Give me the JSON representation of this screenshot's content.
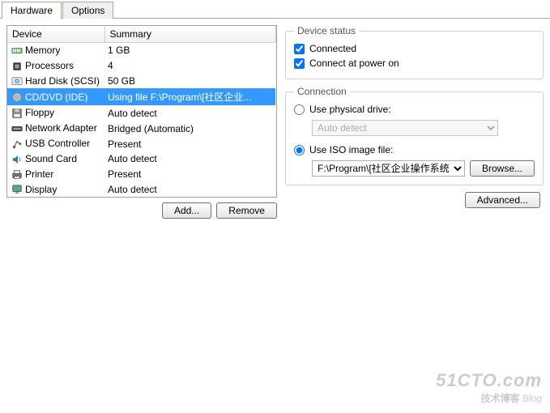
{
  "tabs": {
    "hardware": "Hardware",
    "options": "Options"
  },
  "headers": {
    "device": "Device",
    "summary": "Summary"
  },
  "devices": [
    {
      "name": "Memory",
      "summary": "1 GB",
      "selected": false,
      "iconColor": "#4caf50",
      "iconShape": "memory"
    },
    {
      "name": "Processors",
      "summary": "4",
      "selected": false,
      "iconColor": "#333",
      "iconShape": "cpu"
    },
    {
      "name": "Hard Disk (SCSI)",
      "summary": "50 GB",
      "selected": false,
      "iconColor": "#6bb0e0",
      "iconShape": "disk"
    },
    {
      "name": "CD/DVD (IDE)",
      "summary": "Using file F:\\Program\\[社区企业...",
      "selected": true,
      "iconColor": "#c0c0c0",
      "iconShape": "cd"
    },
    {
      "name": "Floppy",
      "summary": "Auto detect",
      "selected": false,
      "iconColor": "#888",
      "iconShape": "floppy"
    },
    {
      "name": "Network Adapter",
      "summary": "Bridged (Automatic)",
      "selected": false,
      "iconColor": "#555",
      "iconShape": "net"
    },
    {
      "name": "USB Controller",
      "summary": "Present",
      "selected": false,
      "iconColor": "#666",
      "iconShape": "usb"
    },
    {
      "name": "Sound Card",
      "summary": "Auto detect",
      "selected": false,
      "iconColor": "#2a7ab8",
      "iconShape": "sound"
    },
    {
      "name": "Printer",
      "summary": "Present",
      "selected": false,
      "iconColor": "#777",
      "iconShape": "printer"
    },
    {
      "name": "Display",
      "summary": "Auto detect",
      "selected": false,
      "iconColor": "#5a8",
      "iconShape": "display"
    }
  ],
  "buttons": {
    "add": "Add...",
    "remove": "Remove",
    "browse": "Browse...",
    "advanced": "Advanced..."
  },
  "deviceStatus": {
    "legend": "Device status",
    "connected": {
      "label": "Connected",
      "checked": true
    },
    "connectAtPowerOn": {
      "label": "Connect at power on",
      "checked": true
    }
  },
  "connection": {
    "legend": "Connection",
    "physical": {
      "label": "Use physical drive:",
      "checked": false,
      "option": "Auto detect"
    },
    "iso": {
      "label": "Use ISO image file:",
      "checked": true,
      "path": "F:\\Program\\[社区企业操作系统"
    }
  },
  "watermark": {
    "big": "51CTO.com",
    "small": "技术博客",
    "tag": "Blog"
  }
}
